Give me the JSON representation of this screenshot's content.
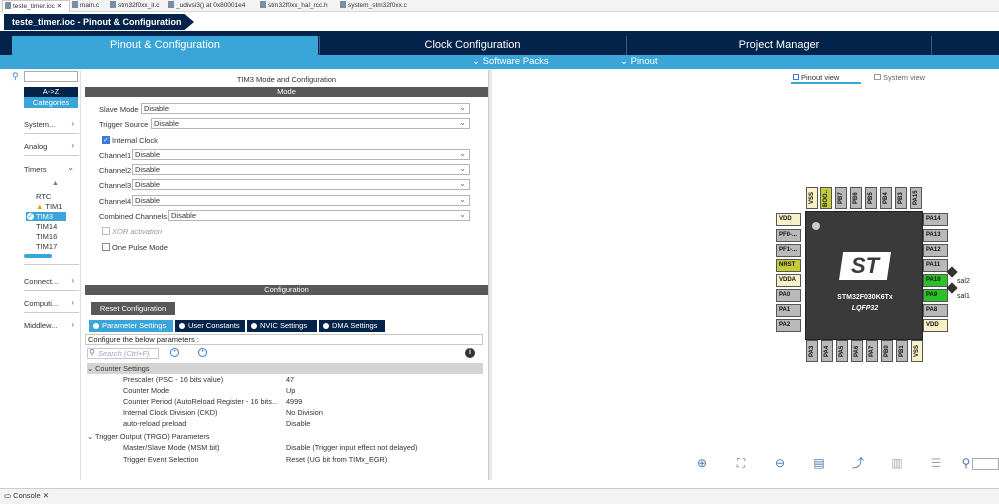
{
  "editor_tabs": [
    "teste_timer.ioc",
    "main.c",
    "stm32f0xx_it.c",
    "_udivsi3() at 0x80001e4",
    "stm32f0xx_hal_rcc.h",
    "system_stm32f0xx.c"
  ],
  "breadcrumb": "teste_timer.ioc - Pinout & Configuration",
  "main_tabs": [
    "Pinout & Configuration",
    "Clock Configuration",
    "Project Manager"
  ],
  "sub_menus": [
    "Software Packs",
    "Pinout"
  ],
  "left": {
    "az": "A->Z",
    "categories": "Categories",
    "items": [
      "System...",
      "Analog",
      "Timers",
      "Connect...",
      "Computi...",
      "Middlew..."
    ],
    "timers": [
      "RTC",
      "TIM1",
      "TIM3",
      "TIM14",
      "TIM16",
      "TIM17"
    ]
  },
  "mode": {
    "title": "TIM3 Mode and Configuration",
    "header": "Mode",
    "fields": [
      {
        "label": "Slave Mode",
        "value": "Disable"
      },
      {
        "label": "Trigger Source",
        "value": "Disable"
      },
      {
        "label": "Channel1",
        "value": "Disable"
      },
      {
        "label": "Channel2",
        "value": "Disable"
      },
      {
        "label": "Channel3",
        "value": "Disable"
      },
      {
        "label": "Channel4",
        "value": "Disable"
      },
      {
        "label": "Combined Channels",
        "value": "Disable"
      }
    ],
    "internal_clock": "Internal Clock",
    "xor": "XOR activation",
    "one_pulse": "One Pulse Mode"
  },
  "config": {
    "header": "Configuration",
    "reset": "Reset Configuration",
    "tabs": [
      "Parameter Settings",
      "User Constants",
      "NVIC Settings",
      "DMA Settings"
    ],
    "configure_text": "Configure the below parameters :",
    "search_placeholder": "Search (Ctrl+F)",
    "groups": [
      {
        "name": "Counter Settings",
        "params": [
          {
            "k": "Prescaler (PSC - 16 bits value)",
            "v": "47"
          },
          {
            "k": "Counter Mode",
            "v": "Up"
          },
          {
            "k": "Counter Period (AutoReload Register - 16 bits...",
            "v": "4999"
          },
          {
            "k": "Internal Clock Division (CKD)",
            "v": "No Division"
          },
          {
            "k": "auto-reload preload",
            "v": "Disable"
          }
        ]
      },
      {
        "name": "Trigger Output (TRGO) Parameters",
        "params": [
          {
            "k": "Master/Slave Mode (MSM bit)",
            "v": "Disable (Trigger input effect not delayed)"
          },
          {
            "k": "Trigger Event Selection",
            "v": "Reset (UG bit from TIMx_EGR)"
          }
        ]
      }
    ]
  },
  "view": {
    "pinout_view": "Pinout view",
    "system_view": "System view"
  },
  "chip": {
    "name": "STM32F030K6Tx",
    "package": "LQFP32",
    "logo": "ST",
    "top_pins": [
      "VSS",
      "BOO..",
      "PB7",
      "PB6",
      "PB5",
      "PB4",
      "PB3",
      "PA15"
    ],
    "left_pins": [
      "VDD",
      "PF0-...",
      "PF1-...",
      "NRST",
      "VDDA",
      "PA0",
      "PA1",
      "PA2"
    ],
    "right_pins": [
      "PA14",
      "PA13",
      "PA12",
      "PA11",
      "PA10",
      "PA9",
      "PA8",
      "VDD"
    ],
    "bottom_pins": [
      "PA3",
      "PA4",
      "PA5",
      "PA6",
      "PA7",
      "PB0",
      "PB1",
      "VSS"
    ],
    "labels": [
      "sal2",
      "sal1"
    ]
  },
  "console": "Console"
}
